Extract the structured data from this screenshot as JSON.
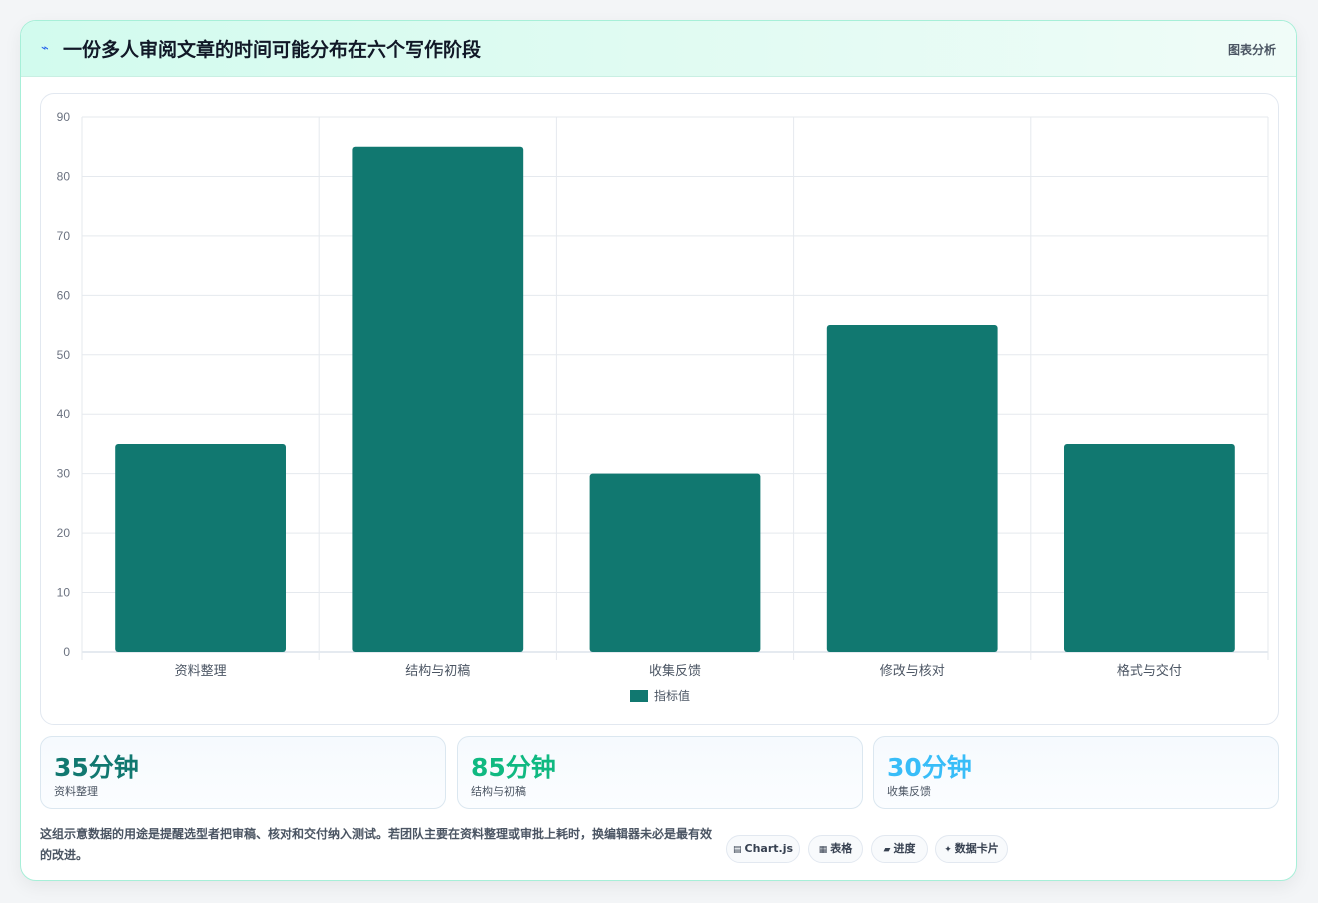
{
  "header": {
    "icon": "bolt-icon",
    "title": "一份多人审阅文章的时间可能分布在六个写作阶段",
    "tag": "图表分析"
  },
  "chart_data": {
    "type": "bar",
    "categories": [
      "资料整理",
      "结构与初稿",
      "收集反馈",
      "修改与核对",
      "格式与交付"
    ],
    "series": [
      {
        "name": "指标值",
        "values": [
          35,
          85,
          30,
          55,
          35
        ],
        "color": "#117870"
      }
    ],
    "ylim": [
      0,
      90
    ],
    "yticks": [
      0,
      10,
      20,
      30,
      40,
      50,
      60,
      70,
      80,
      90
    ],
    "grid": true,
    "legend": "bottom"
  },
  "stats": [
    {
      "value": "35分钟",
      "label": "资料整理",
      "color": "#117870"
    },
    {
      "value": "85分钟",
      "label": "结构与初稿",
      "color": "#10b981"
    },
    {
      "value": "30分钟",
      "label": "收集反馈",
      "color": "#38bdf8"
    }
  ],
  "footer": {
    "note": "这组示意数据的用途是提醒选型者把审稿、核对和交付纳入测试。若团队主要在资料整理或审批上耗时，换编辑器未必是最有效的改进。",
    "chips": [
      {
        "icon": "chart-icon",
        "label": "Chart.js"
      },
      {
        "icon": "table-icon",
        "label": "表格"
      },
      {
        "icon": "progress-icon",
        "label": "进度"
      },
      {
        "icon": "sparkle-icon",
        "label": "数据卡片"
      }
    ]
  }
}
